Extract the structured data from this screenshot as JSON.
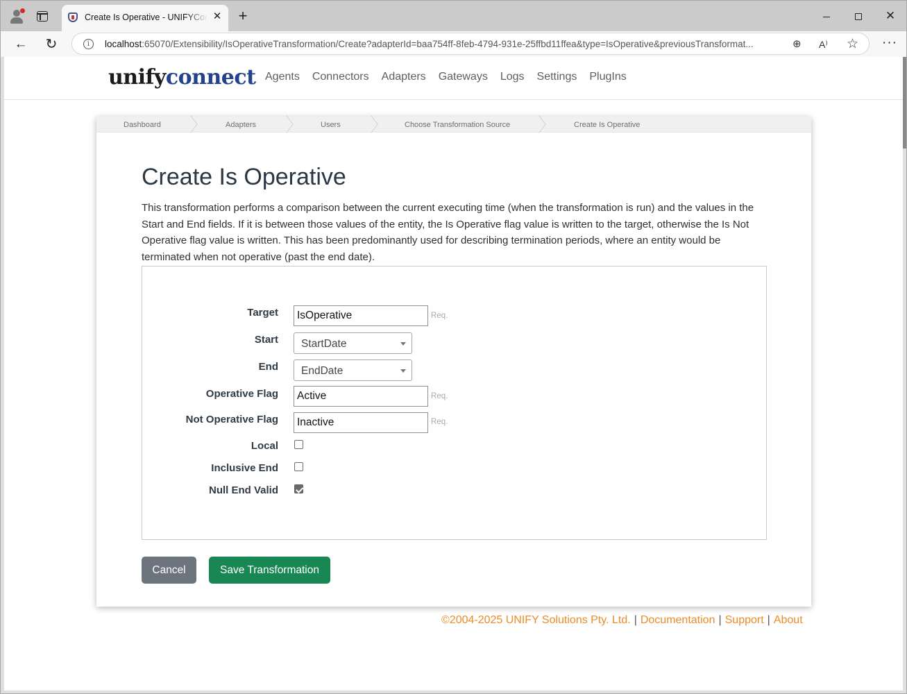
{
  "browser": {
    "tab_title": "Create Is Operative - UNIFYConnect",
    "url_host": "localhost",
    "url_rest": ":65070/Extensibility/IsOperativeTransformation/Create?adapterId=baa754ff-8feb-4794-931e-25ffbd11ffea&type=IsOperative&previousTransformat..."
  },
  "logo": {
    "part1": "unify",
    "part2": "connect"
  },
  "nav": {
    "items": [
      "Agents",
      "Connectors",
      "Adapters",
      "Gateways",
      "Logs",
      "Settings",
      "PlugIns"
    ]
  },
  "breadcrumb": {
    "items": [
      "Dashboard",
      "Adapters",
      "Users",
      "Choose Transformation Source",
      "Create Is Operative"
    ]
  },
  "page": {
    "title": "Create Is Operative",
    "description": "This transformation performs a comparison between the current executing time (when the transformation is run) and the values in the Start and End fields. If it is between those values of the entity, the Is Operative flag value is written to the target, otherwise the Is Not Operative flag value is written. This has been predominantly used for describing termination periods, where an entity would be terminated when not operative (past the end date)."
  },
  "form": {
    "target": {
      "label": "Target",
      "value": "IsOperative",
      "req": "Req."
    },
    "start": {
      "label": "Start",
      "value": "StartDate"
    },
    "end": {
      "label": "End",
      "value": "EndDate"
    },
    "operative_flag": {
      "label": "Operative Flag",
      "value": "Active",
      "req": "Req."
    },
    "not_operative_flag": {
      "label": "Not Operative Flag",
      "value": "Inactive",
      "req": "Req."
    },
    "local": {
      "label": "Local",
      "checked": false
    },
    "inclusive_end": {
      "label": "Inclusive End",
      "checked": false
    },
    "null_end_valid": {
      "label": "Null End Valid",
      "checked": true
    }
  },
  "buttons": {
    "cancel": "Cancel",
    "save": "Save Transformation"
  },
  "footer": {
    "copyright": "©2004-2025 UNIFY Solutions Pty. Ltd.",
    "separator": "|",
    "documentation": "Documentation",
    "support": "Support",
    "about": "About"
  },
  "colors": {
    "logo_connect": "#24418c",
    "save_button": "#198754",
    "cancel_button": "#6c757d",
    "footer_link": "#ed8b25"
  }
}
